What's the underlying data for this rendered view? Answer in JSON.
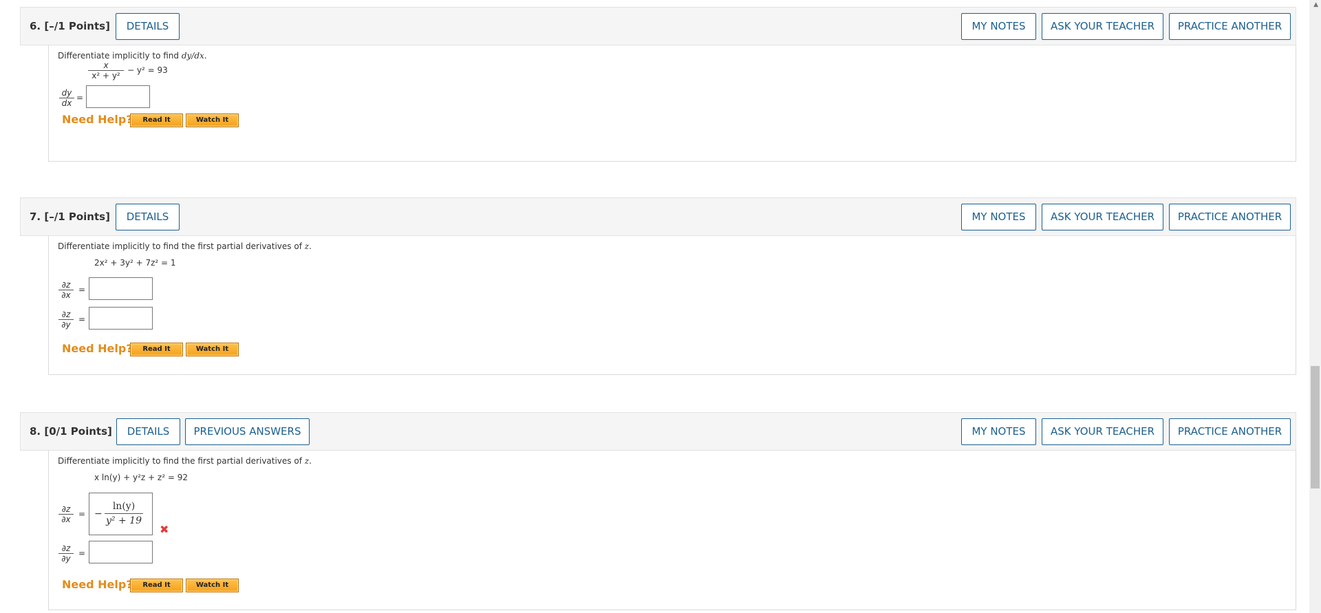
{
  "header_buttons": {
    "my_notes": "MY NOTES",
    "ask_teacher": "ASK YOUR TEACHER",
    "practice_another": "PRACTICE ANOTHER",
    "details": "DETAILS",
    "previous_answers": "PREVIOUS ANSWERS"
  },
  "help": {
    "label": "Need Help?",
    "read_it": "Read It",
    "watch_it": "Watch It"
  },
  "q6": {
    "number": "6. [–/1 Points]",
    "prompt_text": "Differentiate implicitly to find ",
    "prompt_var": "dy/dx",
    "prompt_end": ".",
    "equation_numerator": "x",
    "equation_denominator": "x² + y²",
    "equation_rest": "− y² = 93",
    "derivative_top": "dy",
    "derivative_bottom": "dx",
    "equals": "="
  },
  "q7": {
    "number": "7. [–/1 Points]",
    "prompt_text": "Differentiate implicitly to find the first partial derivatives of ",
    "prompt_var": "z",
    "prompt_end": ".",
    "equation": "2x² + 3y² + 7z² = 1",
    "d1_top": "∂z",
    "d1_bottom": "∂x",
    "d2_top": "∂z",
    "d2_bottom": "∂y",
    "equals": "="
  },
  "q8": {
    "number": "8. [0/1 Points]",
    "prompt_text": "Differentiate implicitly to find the first partial derivatives of ",
    "prompt_var": "z",
    "prompt_end": ".",
    "equation": "x ln(y) + y²z + z² = 92",
    "d1_top": "∂z",
    "d1_bottom": "∂x",
    "d2_top": "∂z",
    "d2_bottom": "∂y",
    "equals": "=",
    "answer_sign": "−",
    "answer_numerator": "ln(y)",
    "answer_denominator": "y² + 19",
    "incorrect_mark": "✖"
  },
  "colors": {
    "link_blue": "#1b5f8f",
    "help_orange": "#e38c1a",
    "error_red": "#e33a3a"
  }
}
